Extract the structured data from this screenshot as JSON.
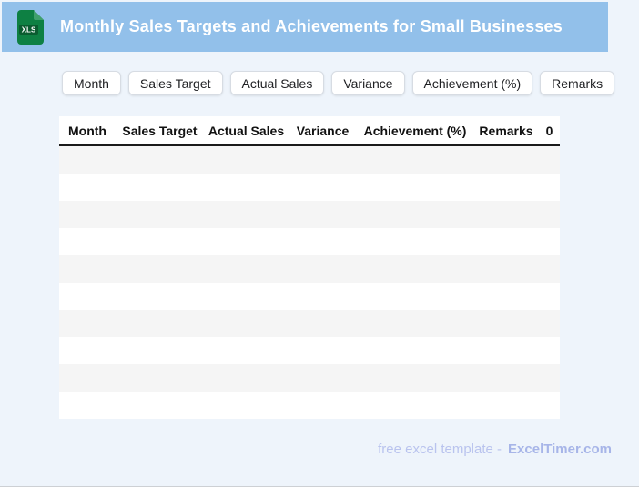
{
  "header": {
    "title": "Monthly Sales Targets and Achievements for Small Businesses",
    "file_badge": "XLS"
  },
  "chips": [
    "Month",
    "Sales Target",
    "Actual Sales",
    "Variance",
    "Achievement (%)",
    "Remarks"
  ],
  "table": {
    "columns": [
      "Month",
      "Sales Target",
      "Actual Sales",
      "Variance",
      "Achievement (%)",
      "Remarks",
      "0"
    ],
    "row_count": 10,
    "rows": []
  },
  "footer": {
    "text": "free excel template -",
    "brand": "ExcelTimer.com"
  },
  "colors": {
    "header_bg": "#92c0ea",
    "page_bg": "#eef4fb",
    "row_stripe": "#f5f5f5",
    "icon_green": "#0e8043",
    "icon_green_dark": "#0a5c30",
    "footer_text": "#b9c3ee",
    "footer_brand": "#a7b5e8"
  }
}
